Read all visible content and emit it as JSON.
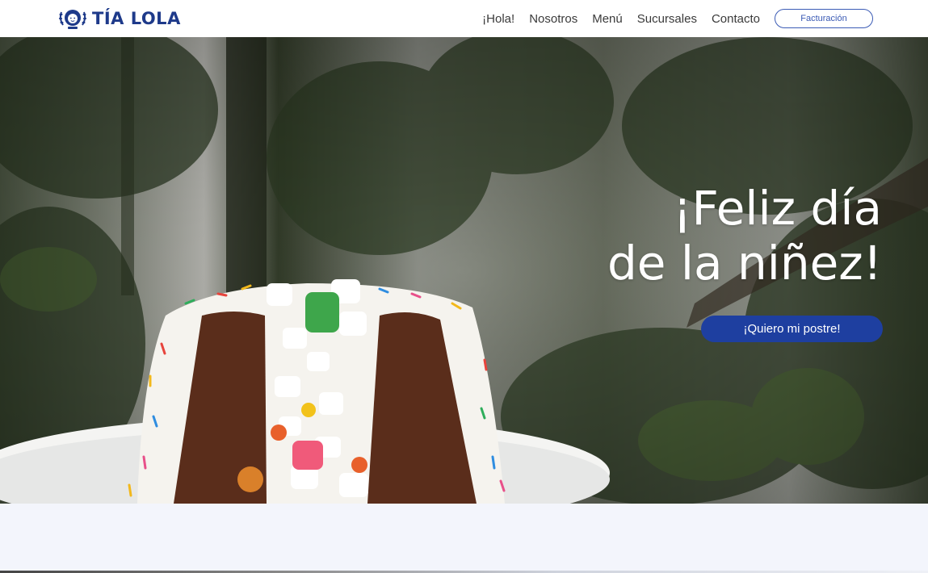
{
  "brand": {
    "name": "TÍA LOLA",
    "logo_icon": "tia-lola-emblem-icon",
    "color": "#1e3a8a"
  },
  "nav": {
    "items": [
      {
        "label": "¡Hola!"
      },
      {
        "label": "Nosotros"
      },
      {
        "label": "Menú"
      },
      {
        "label": "Sucursales"
      },
      {
        "label": "Contacto"
      }
    ],
    "billing_label": "Facturación"
  },
  "hero": {
    "title_line1": "¡Feliz día",
    "title_line2": "de la niñez!",
    "cta_label": "¡Quiero mi postre!",
    "cta_color": "#1e3fa0",
    "image": "cake-with-marshmallows-photo"
  },
  "colors": {
    "accent": "#1e3a8a",
    "section_bg": "#f3f5fc"
  }
}
